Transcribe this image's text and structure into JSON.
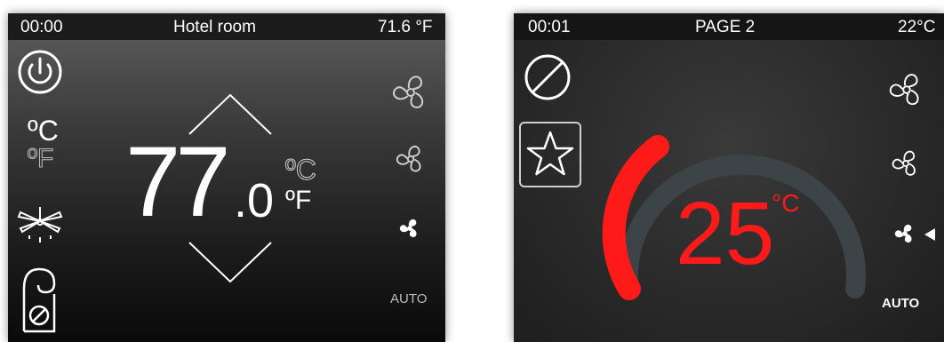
{
  "screen1": {
    "time": "00:00",
    "title": "Hotel room",
    "outdoor_temp": "71.6 °F",
    "setpoint_integer": "77",
    "setpoint_decimal": ".0",
    "unit_celsius_left": "ºC",
    "unit_fahrenheit_left": "ºF",
    "unit_celsius_right": "ºC",
    "unit_fahrenheit_right": "ºF",
    "selected_unit": "ºF",
    "fan_mode_auto": "AUTO",
    "icons": [
      "power-icon",
      "ceiling-fan-icon",
      "do-not-disturb-hanger-icon",
      "fan-high-icon",
      "fan-medium-icon",
      "fan-low-icon",
      "chevron-up-icon",
      "chevron-down-icon"
    ],
    "colors": {
      "text": "#ffffff",
      "dim_text": "#bdbdbd",
      "fan_dim": "#cfcfcf"
    }
  },
  "screen2": {
    "time": "00:01",
    "title": "PAGE 2",
    "outdoor_temp": "22°C",
    "setpoint": "25",
    "unit": "°C",
    "fan_mode_auto": "AUTO",
    "gauge_fraction": 0.32,
    "icons": [
      "no-entry-icon",
      "star-icon",
      "fan-high-icon",
      "fan-medium-icon",
      "fan-low-icon",
      "arrow-left-icon"
    ],
    "colors": {
      "accent": "#ff1a1a",
      "gauge_track": "#3d4448",
      "text": "#ffffff"
    }
  }
}
